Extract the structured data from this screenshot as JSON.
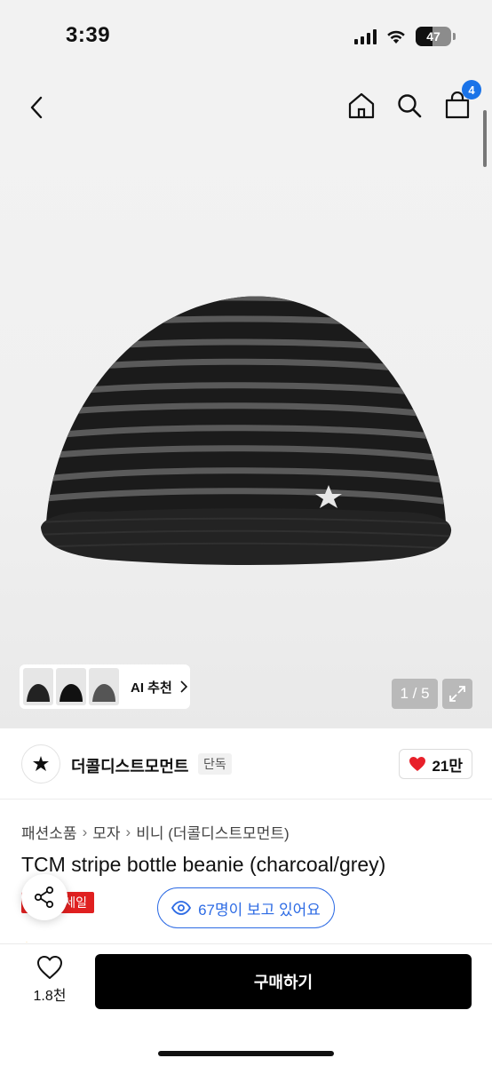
{
  "status_bar": {
    "time": "3:39",
    "battery": "47"
  },
  "nav": {
    "cart_count": "4"
  },
  "gallery": {
    "ai_label": "AI 추천",
    "pager": "1 / 5"
  },
  "brand": {
    "name": "더콜디스트모먼트",
    "tag": "단독",
    "likes": "21만"
  },
  "breadcrumb": [
    "패션소품",
    "모자",
    "비니 (더콜디스트모먼트)"
  ],
  "product": {
    "title": "TCM stripe bottle beanie (charcoal/grey)",
    "sale_label": "세일",
    "viewers": "67명이 보고 있어요"
  },
  "bottom": {
    "wish_count": "1.8천",
    "buy_label": "구매하기"
  },
  "colors": {
    "accent_blue": "#2d6be4",
    "badge_blue": "#1a73e8",
    "sale_red": "#e02020",
    "heart_red": "#e8202a",
    "buy_black": "#000000"
  }
}
